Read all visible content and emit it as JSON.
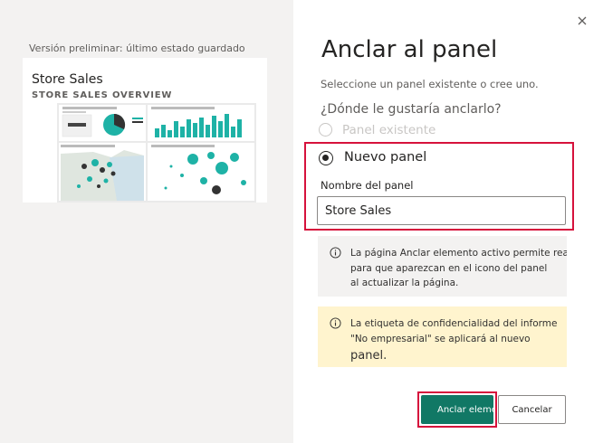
{
  "preview": {
    "label": "Versión preliminar: último estado guardado",
    "card_title": "Store Sales",
    "card_subtitle": "STORE SALES OVERVIEW"
  },
  "dialog": {
    "title": "Anclar al panel",
    "description": "Seleccione un panel existente o cree uno.",
    "question": "¿Dónde le gustaría anclarlo?",
    "options": [
      {
        "label": "Panel existente",
        "selected": false,
        "enabled": false
      },
      {
        "label": "Nuevo panel",
        "selected": true,
        "enabled": true
      }
    ],
    "panel_name_label": "Nombre del panel",
    "panel_name_value": "Store Sales",
    "info_message": {
      "icon": "info-icon",
      "lines": [
        "La página Anclar elemento activo permite realizar c",
        "para que aparezcan en el icono del panel",
        "al actualizar la página."
      ]
    },
    "sensitivity_message": {
      "icon": "info-icon",
      "lines": [
        "La etiqueta de confidencialidad del informe",
        "\"No empresarial\" se aplicará al nuevo",
        "panel."
      ]
    },
    "pin_button": "Anclar elemento",
    "cancel_button": "Cancelar"
  },
  "colors": {
    "accent": "#117865",
    "highlight": "#d6123c",
    "warning_bg": "#fff4ce",
    "info_bg": "#f3f2f1"
  }
}
